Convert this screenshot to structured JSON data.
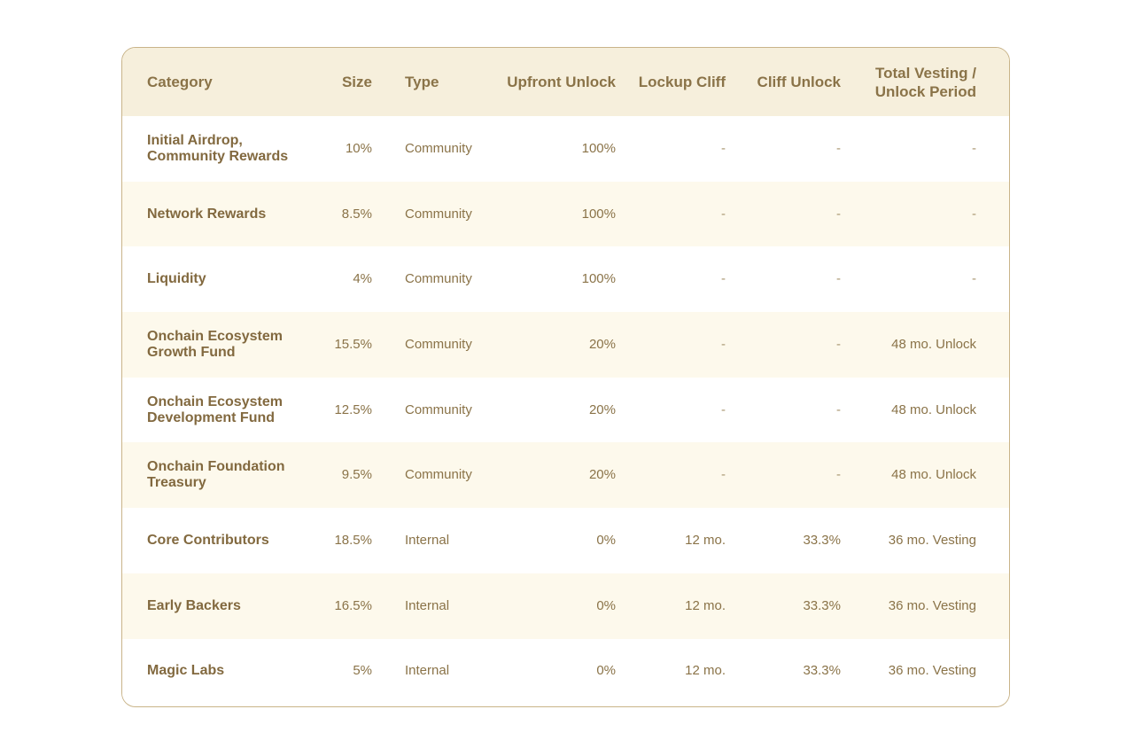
{
  "table": {
    "headers": {
      "category": "Category",
      "size": "Size",
      "type": "Type",
      "upfront_unlock": "Upfront Unlock",
      "lockup_cliff": "Lockup Cliff",
      "cliff_unlock": "Cliff Unlock",
      "total_vesting_line1": "Total Vesting /",
      "total_vesting_line2": "Unlock Period"
    },
    "rows": [
      {
        "category_line1": "Initial Airdrop,",
        "category_line2": "Community Rewards",
        "size": "10%",
        "type": "Community",
        "upfront_unlock": "100%",
        "lockup_cliff": "-",
        "cliff_unlock": "-",
        "total_vesting": "-"
      },
      {
        "category_line1": "Network Rewards",
        "category_line2": "",
        "size": "8.5%",
        "type": "Community",
        "upfront_unlock": "100%",
        "lockup_cliff": "-",
        "cliff_unlock": "-",
        "total_vesting": "-"
      },
      {
        "category_line1": "Liquidity",
        "category_line2": "",
        "size": "4%",
        "type": "Community",
        "upfront_unlock": "100%",
        "lockup_cliff": "-",
        "cliff_unlock": "-",
        "total_vesting": "-"
      },
      {
        "category_line1": "Onchain Ecosystem",
        "category_line2": "Growth Fund",
        "size": "15.5%",
        "type": "Community",
        "upfront_unlock": "20%",
        "lockup_cliff": "-",
        "cliff_unlock": "-",
        "total_vesting": "48 mo. Unlock"
      },
      {
        "category_line1": "Onchain Ecosystem",
        "category_line2": "Development Fund",
        "size": "12.5%",
        "type": "Community",
        "upfront_unlock": "20%",
        "lockup_cliff": "-",
        "cliff_unlock": "-",
        "total_vesting": "48 mo. Unlock"
      },
      {
        "category_line1": "Onchain Foundation",
        "category_line2": "Treasury",
        "size": "9.5%",
        "type": "Community",
        "upfront_unlock": "20%",
        "lockup_cliff": "-",
        "cliff_unlock": "-",
        "total_vesting": "48 mo. Unlock"
      },
      {
        "category_line1": "Core Contributors",
        "category_line2": "",
        "size": "18.5%",
        "type": "Internal",
        "upfront_unlock": "0%",
        "lockup_cliff": "12 mo.",
        "cliff_unlock": "33.3%",
        "total_vesting": "36 mo. Vesting"
      },
      {
        "category_line1": "Early Backers",
        "category_line2": "",
        "size": "16.5%",
        "type": "Internal",
        "upfront_unlock": "0%",
        "lockup_cliff": "12 mo.",
        "cliff_unlock": "33.3%",
        "total_vesting": "36 mo. Vesting"
      },
      {
        "category_line1": "Magic Labs",
        "category_line2": "",
        "size": "5%",
        "type": "Internal",
        "upfront_unlock": "0%",
        "lockup_cliff": "12 mo.",
        "cliff_unlock": "33.3%",
        "total_vesting": "36 mo. Vesting"
      }
    ]
  },
  "colors": {
    "header_bg": "#f6efdc",
    "stripe_bg": "#fdf9ec",
    "text": "#8a7348",
    "border": "#c9b489"
  }
}
